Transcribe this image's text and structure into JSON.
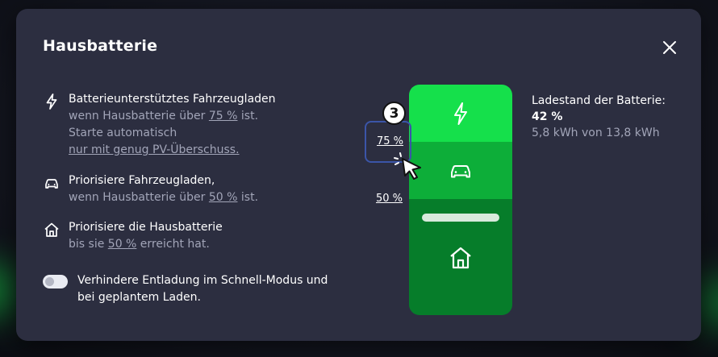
{
  "modal": {
    "title": "Hausbatterie"
  },
  "options": [
    {
      "icon": "lightning-icon",
      "head": "Batterieunterstütztes Fahrzeugladen",
      "line1_pre": "wenn Hausbatterie über ",
      "line1_value": "75 %",
      "line1_post": " ist.",
      "line2": "Starte automatisch",
      "line3_link": "nur mit genug PV-Überschuss."
    },
    {
      "icon": "car-icon",
      "head": "Priorisiere Fahrzeugladen,",
      "line1_pre": "wenn Hausbatterie über ",
      "line1_value": "50 %",
      "line1_post": " ist."
    },
    {
      "icon": "home-icon",
      "head": "Priorisiere die Hausbatterie",
      "line1_pre": "bis sie ",
      "line1_value": "50 %",
      "line1_post": " erreicht hat."
    }
  ],
  "toggle": {
    "label_line1": "Verhindere Entladung im Schnell-Modus und",
    "label_line2": "bei geplantem Laden.",
    "on": false
  },
  "battery": {
    "threshold_upper": "75 %",
    "threshold_lower": "50 %",
    "step_badge": "3",
    "charge_level_percent": 42,
    "colors": {
      "top": "#15e04b",
      "middle": "#0dae39",
      "bottom": "#067d2a"
    }
  },
  "status": {
    "label": "Ladestand der Batterie:",
    "percent": "42 %",
    "energy": "5,8 kWh von 13,8 kWh"
  }
}
